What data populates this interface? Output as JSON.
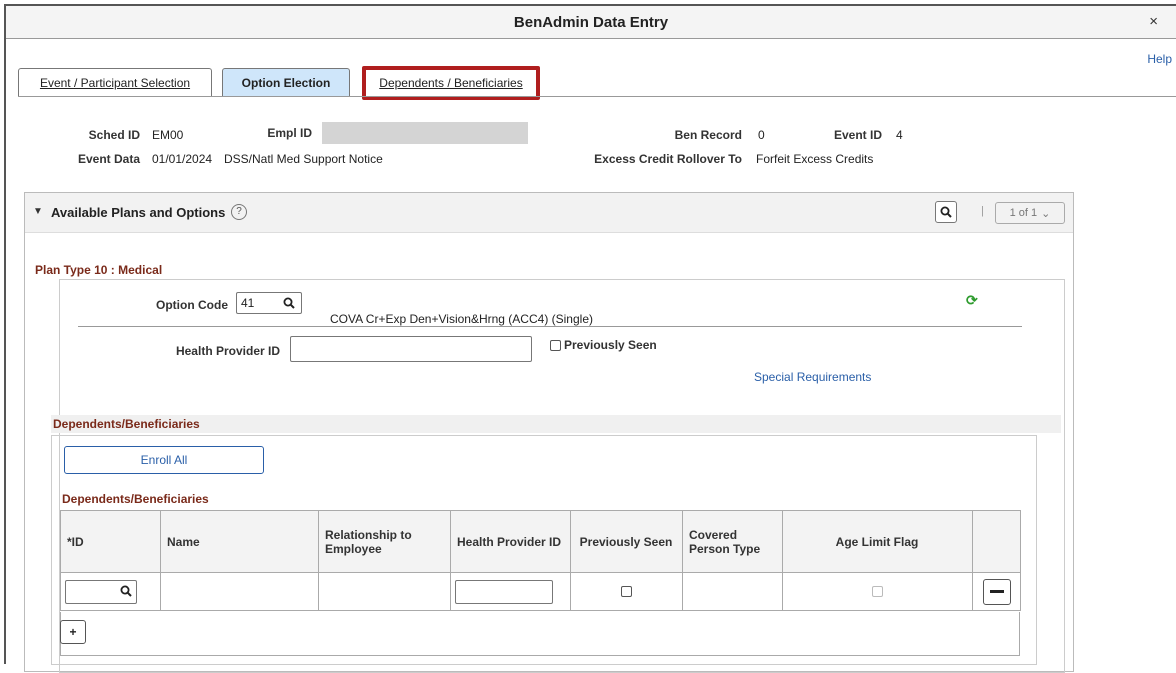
{
  "window": {
    "title": "BenAdmin Data Entry",
    "close_label": "×",
    "help_label": "Help"
  },
  "tabs": [
    {
      "label": "Event / Participant Selection"
    },
    {
      "label": "Option Election"
    },
    {
      "label": "Dependents / Beneficiaries"
    }
  ],
  "header": {
    "sched_id_label": "Sched ID",
    "sched_id_value": "EM00",
    "empl_id_label": "Empl ID",
    "ben_record_label": "Ben Record",
    "ben_record_value": "0",
    "event_id_label": "Event ID",
    "event_id_value": "4",
    "event_data_label": "Event Data",
    "event_data_date": "01/01/2024",
    "event_data_text": "DSS/Natl Med Support Notice",
    "excess_label": "Excess Credit Rollover To",
    "excess_value": "Forfeit Excess Credits"
  },
  "section": {
    "title": "Available Plans and Options",
    "help_icon": "?",
    "pager": "1 of 1"
  },
  "plan": {
    "title": "Plan Type 10 : Medical",
    "option_code_label": "Option Code",
    "option_code_value": "41",
    "option_description": "COVA Cr+Exp Den+Vision&Hrng (ACC4) (Single)",
    "health_provider_label": "Health Provider ID",
    "health_provider_value": "",
    "previously_seen_label": "Previously Seen",
    "special_req_link": "Special Requirements"
  },
  "dependents": {
    "outer_title": "Dependents/Beneficiaries",
    "enroll_all_label": "Enroll All",
    "grid_title": "Dependents/Beneficiaries",
    "columns": [
      "*ID",
      "Name",
      "Relationship to Employee",
      "Health Provider ID",
      "Previously Seen",
      "Covered Person Type",
      "Age Limit Flag"
    ],
    "add_row_label": "+",
    "delete_row_label": "—"
  },
  "colors": {
    "accent_blue": "#2a5fa8",
    "tab_active": "#cfe6fa",
    "highlight_red": "#b01e1e",
    "section_title": "#7a2a1a",
    "refresh_green": "#2e9b2e"
  }
}
